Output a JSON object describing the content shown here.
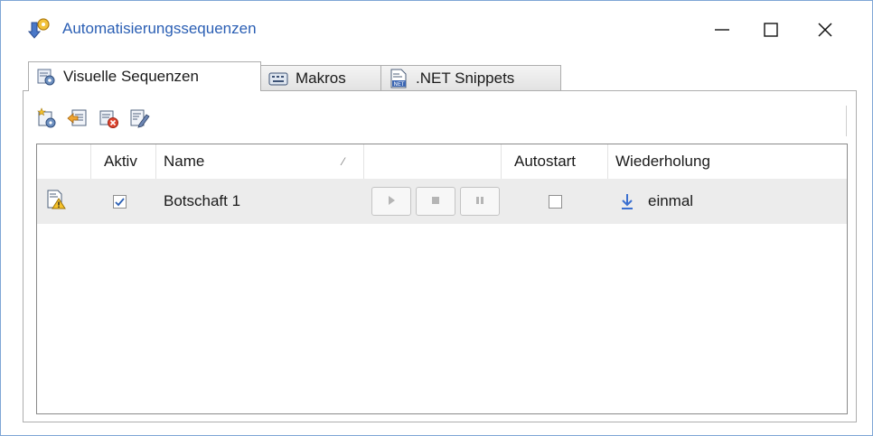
{
  "window": {
    "title": "Automatisierungssequenzen",
    "controls": [
      "minimize",
      "maximize",
      "close"
    ]
  },
  "tabs": [
    {
      "label": "Visuelle Sequenzen",
      "icon": "visual-sequence-icon",
      "active": true
    },
    {
      "label": "Makros",
      "icon": "keyboard-icon",
      "active": false
    },
    {
      "label": ".NET Snippets",
      "icon": "net-file-icon",
      "active": false
    }
  ],
  "toolbar": {
    "buttons": [
      {
        "name": "new-sequence-icon"
      },
      {
        "name": "import-sequence-icon"
      },
      {
        "name": "delete-sequence-icon"
      },
      {
        "name": "edit-sequence-icon"
      }
    ]
  },
  "grid": {
    "columns": {
      "status": "",
      "active": "Aktiv",
      "name": "Name",
      "controls": "",
      "autostart": "Autostart",
      "repeat": "Wiederholung"
    },
    "rows": [
      {
        "status_icon": "warning-document-icon",
        "active": true,
        "name": "Botschaft 1",
        "autostart": false,
        "repeat_icon": "arrow-down-icon",
        "repeat": "einmal"
      }
    ]
  },
  "colors": {
    "title_text": "#2b5fb4",
    "window_border": "#7fa6d6",
    "row_background": "#ececec",
    "repeat_arrow": "#3a6fd0"
  }
}
